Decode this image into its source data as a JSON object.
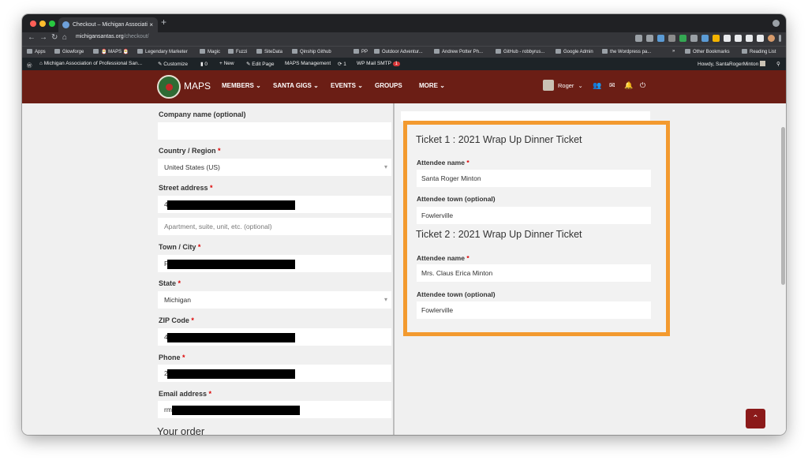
{
  "browser": {
    "tab_title": "Checkout – Michigan Associati",
    "tab_close": "×",
    "new_tab": "+",
    "url_host": "michigansantas.org",
    "url_path": "/checkout/",
    "bookmarks": [
      "Apps",
      "Glowforge",
      "🎅 MAPS 🎅",
      "Legendary Marketer",
      "Magic",
      "Fuzzi",
      "SiteData",
      "Qinship Github",
      "PP",
      "Outdoor Adventur...",
      "Andrew Potter Ph...",
      "GitHub - robbyrus...",
      "Google Admin",
      "the Wordpress pa..."
    ],
    "bookmarks_more": "»",
    "other_bookmarks": "Other Bookmarks",
    "reading_list": "Reading List"
  },
  "wp_admin_bar": {
    "site_name": "Michigan Association of Professional San...",
    "customize": "Customize",
    "comments": "0",
    "new": "New",
    "edit_page": "Edit Page",
    "maps_management": "MAPS Management",
    "updates": "1",
    "wp_mail_smtp": "WP Mail SMTP",
    "smtp_badge": "1",
    "howdy": "Howdy, SantaRogerMinton"
  },
  "site_nav": {
    "brand": "MAPS",
    "items": [
      "MEMBERS ⌄",
      "SANTA GIGS ⌄",
      "EVENTS ⌄",
      "GROUPS",
      "MORE ⌄"
    ],
    "user_name": "Roger"
  },
  "billing_form": {
    "company_label": "Company name (optional)",
    "company_value": "",
    "country_label": "Country / Region",
    "country_value": "United States (US)",
    "street_label": "Street address",
    "street_value": "4",
    "street2_placeholder": "Apartment, suite, unit, etc. (optional)",
    "town_label": "Town / City",
    "town_value": "F",
    "state_label": "State",
    "state_value": "Michigan",
    "zip_label": "ZIP Code",
    "zip_value": "4",
    "phone_label": "Phone",
    "phone_value": "2",
    "email_label": "Email address",
    "email_value": "rm",
    "required_mark": "*",
    "your_order": "Your order"
  },
  "tickets": [
    {
      "title": "Ticket 1 : 2021 Wrap Up Dinner Ticket",
      "name_label": "Attendee name",
      "name_value": "Santa Roger Minton",
      "town_label": "Attendee town (optional)",
      "town_value": "Fowlerville"
    },
    {
      "title": "Ticket 2 : 2021 Wrap Up Dinner Ticket",
      "name_label": "Attendee name",
      "name_value": "Mrs. Claus Erica Minton",
      "town_label": "Attendee town (optional)",
      "town_value": "Fowlerville"
    }
  ],
  "colors": {
    "nav_bg": "#6b1e15",
    "highlight": "#f39a2f",
    "required": "#dd0000"
  }
}
